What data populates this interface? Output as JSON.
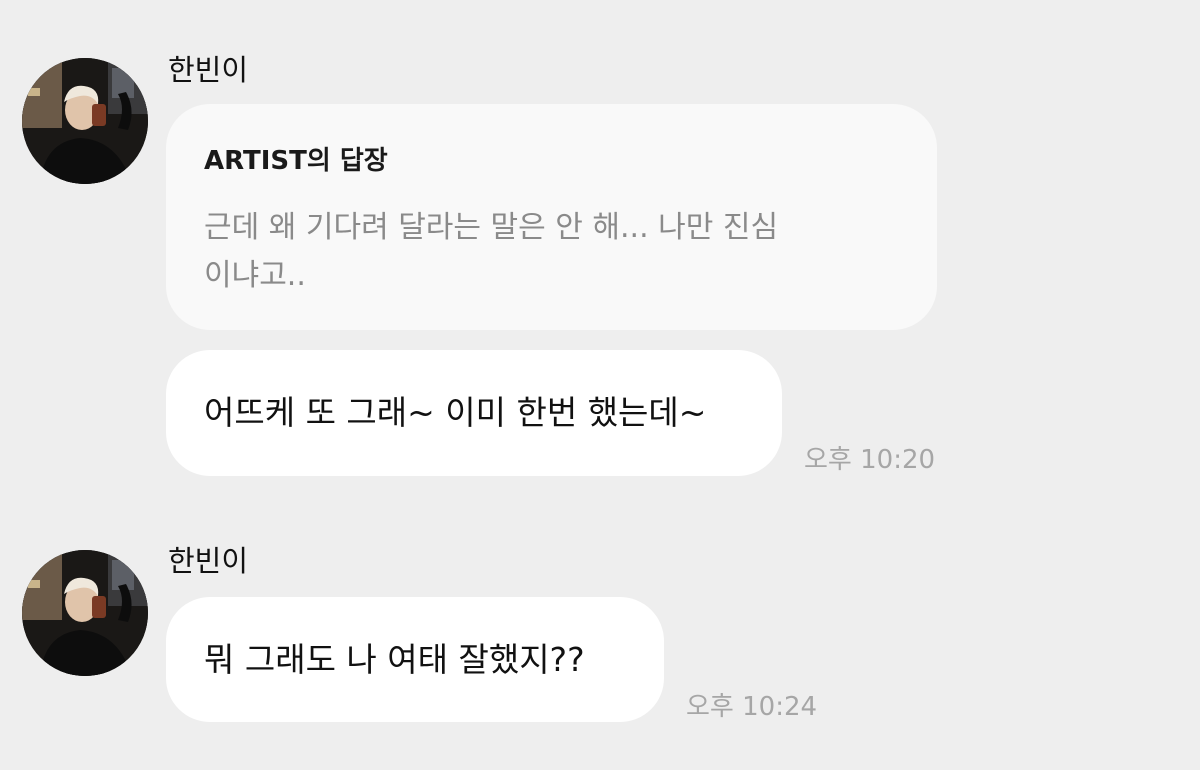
{
  "messages": [
    {
      "sender": "한빈이",
      "reply": {
        "title": "ARTIST의 답장",
        "quote": "근데 왜 기다려 달라는 말은 안 해... 나만 진심이냐고.."
      },
      "text": "어뜨케 또 그래~ 이미 한번 했는데~",
      "time": "오후 10:20"
    },
    {
      "sender": "한빈이",
      "text": "뭐 그래도 나 여태 잘했지??",
      "time": "오후 10:24"
    }
  ]
}
